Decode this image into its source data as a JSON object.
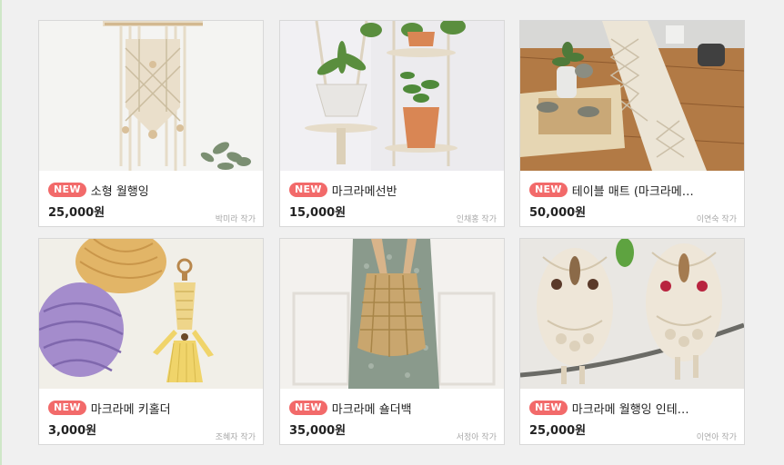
{
  "badge_label": "NEW",
  "products": [
    {
      "title": "소형 월행잉",
      "price": "25,000원",
      "artist": "박미라 작가",
      "image": "macrame-wall-hanging-photo"
    },
    {
      "title": "마크라메선반",
      "price": "15,000원",
      "artist": "인채홍 작가",
      "image": "macrame-plant-shelf-photo"
    },
    {
      "title": "테이블 매트 (마크라메…",
      "price": "50,000원",
      "artist": "이연숙 작가",
      "image": "macrame-table-runner-photo"
    },
    {
      "title": "마크라메 키홀더",
      "price": "3,000원",
      "artist": "조혜자 작가",
      "image": "macrame-keyholder-photo"
    },
    {
      "title": "마크라메 숄더백",
      "price": "35,000원",
      "artist": "서정아 작가",
      "image": "macrame-shoulder-bag-photo"
    },
    {
      "title": "마크라메 월행잉 인테…",
      "price": "25,000원",
      "artist": "이연아 작가",
      "image": "macrame-owl-wall-hanging-photo"
    }
  ],
  "colors": {
    "badge": "#f26a6a",
    "border": "#d8d8d8",
    "background": "#f0f0f0"
  }
}
